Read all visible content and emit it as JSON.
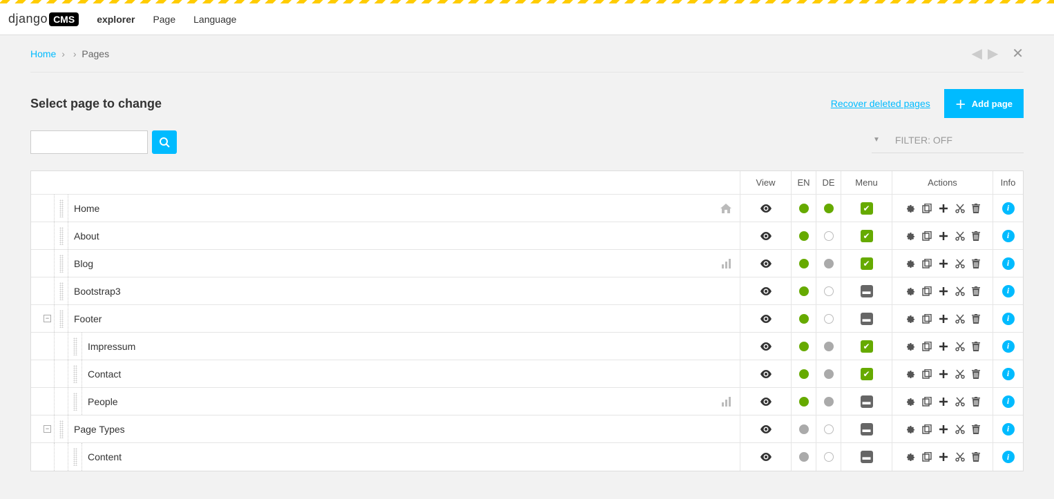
{
  "brand": {
    "part1": "django",
    "part2": "CMS"
  },
  "toolbar": {
    "items": [
      {
        "label": "explorer",
        "bold": true
      },
      {
        "label": "Page",
        "bold": false
      },
      {
        "label": "Language",
        "bold": false
      }
    ]
  },
  "breadcrumb": {
    "home": "Home",
    "current": "Pages",
    "sep": "›"
  },
  "header": {
    "title": "Select page to change",
    "recover_link": "Recover deleted pages",
    "add_button": "Add page"
  },
  "filter": {
    "label": "FILTER: OFF"
  },
  "columns": {
    "view": "View",
    "en": "EN",
    "de": "DE",
    "menu": "Menu",
    "actions": "Actions",
    "info": "Info"
  },
  "pages": [
    {
      "name": "Home",
      "depth": 0,
      "expander": null,
      "indicator": "home",
      "en": "green",
      "de": "green",
      "menu": "on"
    },
    {
      "name": "About",
      "depth": 0,
      "expander": null,
      "indicator": null,
      "en": "green",
      "de": "empty",
      "menu": "on"
    },
    {
      "name": "Blog",
      "depth": 0,
      "expander": null,
      "indicator": "app",
      "en": "green",
      "de": "grey",
      "menu": "on"
    },
    {
      "name": "Bootstrap3",
      "depth": 0,
      "expander": null,
      "indicator": null,
      "en": "green",
      "de": "empty",
      "menu": "off"
    },
    {
      "name": "Footer",
      "depth": 0,
      "expander": "open",
      "indicator": null,
      "en": "green",
      "de": "empty",
      "menu": "off"
    },
    {
      "name": "Impressum",
      "depth": 1,
      "expander": null,
      "indicator": null,
      "en": "green",
      "de": "grey",
      "menu": "on"
    },
    {
      "name": "Contact",
      "depth": 1,
      "expander": null,
      "indicator": null,
      "en": "green",
      "de": "grey",
      "menu": "on"
    },
    {
      "name": "People",
      "depth": 1,
      "expander": null,
      "indicator": "app",
      "en": "green",
      "de": "grey",
      "menu": "off"
    },
    {
      "name": "Page Types",
      "depth": 0,
      "expander": "open",
      "indicator": null,
      "en": "grey",
      "de": "empty",
      "menu": "off"
    },
    {
      "name": "Content",
      "depth": 1,
      "expander": null,
      "indicator": null,
      "en": "grey",
      "de": "empty",
      "menu": "off"
    }
  ]
}
